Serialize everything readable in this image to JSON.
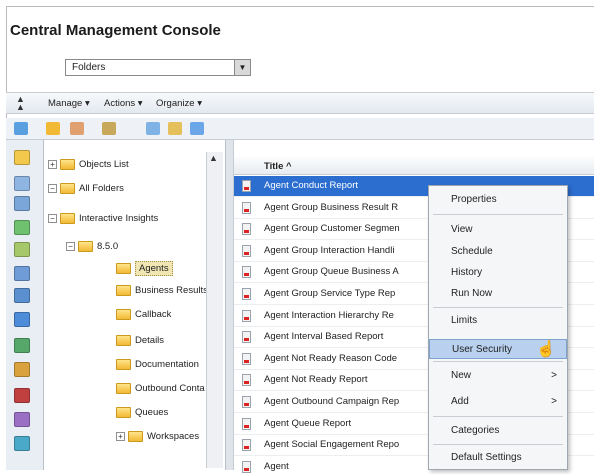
{
  "app": {
    "title": "Central Management Console"
  },
  "folder_select": {
    "value": "Folders"
  },
  "menubar": {
    "manage": "Manage",
    "actions": "Actions",
    "organize": "Organize"
  },
  "tree": [
    {
      "label": "Objects List",
      "indent": 0,
      "expander": "+"
    },
    {
      "label": "All Folders",
      "indent": 0,
      "expander": "−"
    },
    {
      "label": "Interactive Insights",
      "indent": 1,
      "expander": "−"
    },
    {
      "label": "8.5.0",
      "indent": 2,
      "expander": "−"
    },
    {
      "label": "Agents",
      "indent": 3,
      "expander": "",
      "selected": true
    },
    {
      "label": "Business Results",
      "indent": 3,
      "expander": ""
    },
    {
      "label": "Callback",
      "indent": 3,
      "expander": ""
    },
    {
      "label": "Details",
      "indent": 3,
      "expander": ""
    },
    {
      "label": "Documentation",
      "indent": 3,
      "expander": ""
    },
    {
      "label": "Outbound Conta",
      "indent": 3,
      "expander": ""
    },
    {
      "label": "Queues",
      "indent": 3,
      "expander": ""
    },
    {
      "label": "Workspaces",
      "indent": 3,
      "expander": "+"
    }
  ],
  "grid": {
    "column_title": "Title ^",
    "rows": [
      "Agent Conduct Report",
      "Agent Group Business Result R",
      "Agent Group Customer Segmen",
      "Agent Group Interaction Handli",
      "Agent Group Queue Business A",
      "Agent Group Service Type Rep",
      "Agent Interaction Hierarchy Re",
      "Agent Interval Based Report",
      "Agent Not Ready Reason Code",
      "Agent Not Ready Report",
      "Agent Outbound Campaign Rep",
      "Agent Queue Report",
      "Agent Social Engagement Repo",
      "Agent"
    ]
  },
  "context_menu": {
    "properties": "Properties",
    "view": "View",
    "schedule": "Schedule",
    "history": "History",
    "run_now": "Run Now",
    "limits": "Limits",
    "user_security": "User Security",
    "new": "New",
    "add": "Add",
    "categories": "Categories",
    "default_settings": "Default Settings",
    "submenu_arrow": ">"
  },
  "colors": {
    "selection_blue": "#2b6ed0",
    "menu_highlight": "#b9d1ee",
    "folder_yellow": "#f2b935"
  }
}
